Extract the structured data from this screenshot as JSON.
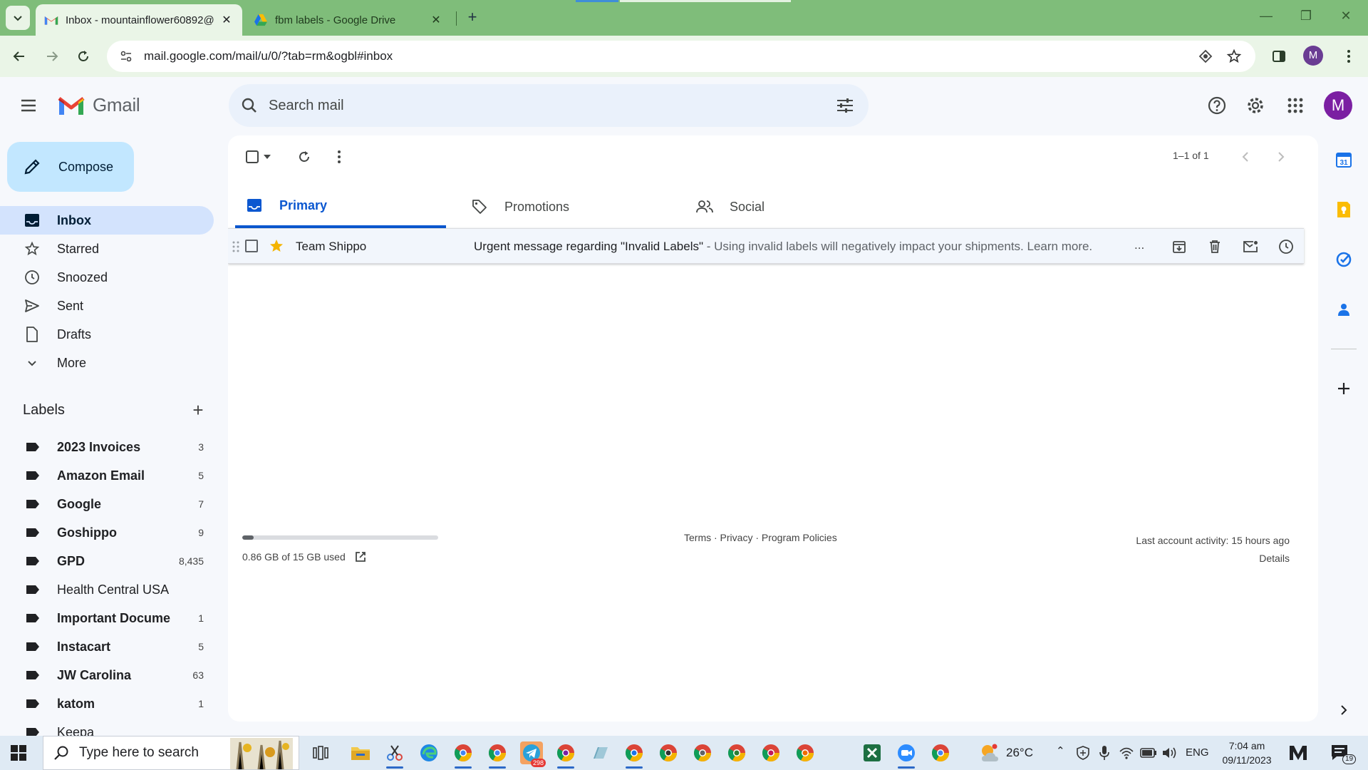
{
  "browser": {
    "tabs": [
      {
        "title": "Inbox - mountainflower60892@",
        "active": true
      },
      {
        "title": "fbm labels - Google Drive",
        "active": false
      }
    ],
    "url": "mail.google.com/mail/u/0/?tab=rm&ogbl#inbox",
    "profile_initial": "M"
  },
  "header": {
    "app_name": "Gmail",
    "search_placeholder": "Search mail",
    "avatar_initial": "M"
  },
  "sidebar": {
    "compose_label": "Compose",
    "nav": [
      {
        "label": "Inbox",
        "icon": "inbox-icon",
        "active": true
      },
      {
        "label": "Starred",
        "icon": "star-icon"
      },
      {
        "label": "Snoozed",
        "icon": "clock-icon"
      },
      {
        "label": "Sent",
        "icon": "send-icon"
      },
      {
        "label": "Drafts",
        "icon": "draft-icon"
      },
      {
        "label": "More",
        "icon": "chevron-down-icon"
      }
    ],
    "labels_title": "Labels",
    "labels": [
      {
        "name": "2023 Invoices",
        "count": "3",
        "bold": true
      },
      {
        "name": "Amazon Email",
        "count": "5",
        "bold": true
      },
      {
        "name": "Google",
        "count": "7",
        "bold": true
      },
      {
        "name": "Goshippo",
        "count": "9",
        "bold": true
      },
      {
        "name": "GPD",
        "count": "8,435",
        "bold": true
      },
      {
        "name": "Health Central USA",
        "count": "",
        "bold": false
      },
      {
        "name": "Important Docume...",
        "count": "1",
        "bold": true
      },
      {
        "name": "Instacart",
        "count": "5",
        "bold": true
      },
      {
        "name": "JW Carolina",
        "count": "63",
        "bold": true
      },
      {
        "name": "katom",
        "count": "1",
        "bold": true
      },
      {
        "name": "Keepa",
        "count": "",
        "bold": false
      }
    ]
  },
  "main": {
    "pager_text": "1–1 of 1",
    "tabs": [
      {
        "label": "Primary",
        "active": true
      },
      {
        "label": "Promotions",
        "active": false
      },
      {
        "label": "Social",
        "active": false
      }
    ],
    "messages": [
      {
        "sender": "Team Shippo",
        "subject": "Urgent message regarding \"Invalid Labels\"",
        "snippet": " - Using invalid labels will negatively impact your shipments. Learn more.",
        "ellipsis": "...",
        "starred": true
      }
    ],
    "storage_text": "0.86 GB of 15 GB used",
    "storage_fraction": 0.057,
    "footer_links": "Terms · Privacy · Program Policies",
    "last_activity": "Last account activity: 15 hours ago",
    "details_link": "Details"
  },
  "taskbar": {
    "search_placeholder": "Type here to search",
    "weather": "26°C",
    "language": "ENG",
    "time": "7:04 am",
    "date": "09/11/2023",
    "telegram_badge": "298",
    "notifications_count": "19"
  },
  "colors": {
    "tabbar": "#7fbd7a",
    "compose": "#c2e7ff",
    "active_nav": "#d3e3fd",
    "primary_blue": "#0b57d0",
    "star": "#f4b400"
  }
}
